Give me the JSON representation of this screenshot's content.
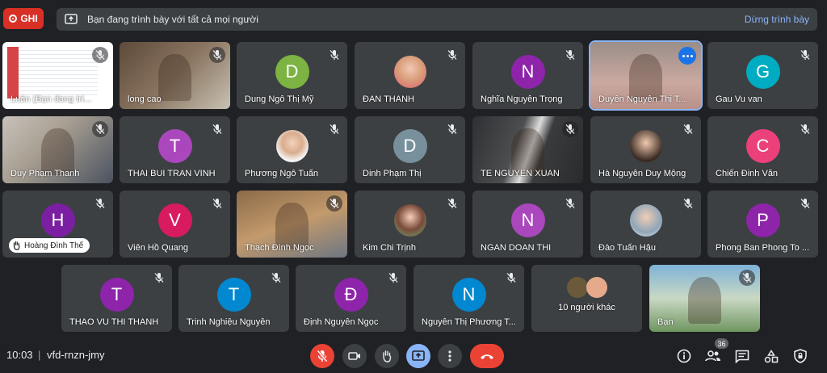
{
  "recording": {
    "label": "GHI"
  },
  "presenting": {
    "message": "Bạn đang trình bày với tất cả mọi người",
    "stop_label": "Dừng trình bày"
  },
  "tiles": [
    {
      "name": "Luân (Bạn đang trì...",
      "kind": "screen"
    },
    {
      "name": "long cao",
      "kind": "video"
    },
    {
      "name": "Dung Ngô Thị Mỹ",
      "kind": "initial",
      "initial": "D",
      "color": "#7cb342"
    },
    {
      "name": "ĐAN THANH",
      "kind": "photo"
    },
    {
      "name": "Nghĩa Nguyễn Trọng",
      "kind": "initial",
      "initial": "N",
      "color": "#8e24aa"
    },
    {
      "name": "Duyên Nguyễn Thị T...",
      "kind": "video",
      "active": true
    },
    {
      "name": "Gau Vu van",
      "kind": "initial",
      "initial": "G",
      "color": "#00acc1"
    },
    {
      "name": "Duy Phạm Thanh",
      "kind": "video"
    },
    {
      "name": "THAI BUI TRAN VINH",
      "kind": "initial",
      "initial": "T",
      "color": "#ab47bc"
    },
    {
      "name": "Phương Ngô Tuấn",
      "kind": "photo"
    },
    {
      "name": "Dinh Phạm Thị",
      "kind": "initial",
      "initial": "D",
      "color": "#78909c"
    },
    {
      "name": "TE NGUYEN XUAN",
      "kind": "video"
    },
    {
      "name": "Hà Nguyễn Duy Mộng",
      "kind": "photo"
    },
    {
      "name": "Chiến Đinh Văn",
      "kind": "initial",
      "initial": "C",
      "color": "#ec407a"
    },
    {
      "name": "",
      "kind": "initial",
      "initial": "H",
      "color": "#7b1fa2",
      "hand": "Hoàng Đình Thế"
    },
    {
      "name": "Viên Hồ Quang",
      "kind": "initial",
      "initial": "V",
      "color": "#d81b60"
    },
    {
      "name": "Thạch Đình Ngọc",
      "kind": "video"
    },
    {
      "name": "Kim Chi Trịnh",
      "kind": "photo"
    },
    {
      "name": "NGAN DOAN THI",
      "kind": "initial",
      "initial": "N",
      "color": "#ab47bc"
    },
    {
      "name": "Đào Tuấn Hậu",
      "kind": "photo"
    },
    {
      "name": "Phong Ban Phong To ...",
      "kind": "initial",
      "initial": "P",
      "color": "#8e24aa"
    },
    {
      "name": "THAO VU THI THANH",
      "kind": "initial",
      "initial": "T",
      "color": "#8e24aa"
    },
    {
      "name": "Trinh Nghiệu Nguyễn",
      "kind": "initial",
      "initial": "T",
      "color": "#0288d1"
    },
    {
      "name": "Định Nguyễn Ngọc",
      "kind": "initial",
      "initial": "Đ",
      "color": "#8e24aa"
    },
    {
      "name": "Nguyễn Thị Phương T...",
      "kind": "initial",
      "initial": "N",
      "color": "#0288d1"
    },
    {
      "name": "10 người khác",
      "kind": "others"
    },
    {
      "name": "Bạn",
      "kind": "video"
    }
  ],
  "footer": {
    "time": "10:03",
    "meeting_code": "vfd-rnzn-jmy",
    "participant_count": "36"
  },
  "colors": {
    "accent": "#8ab4f8",
    "danger": "#ea4335",
    "record": "#d93025"
  }
}
